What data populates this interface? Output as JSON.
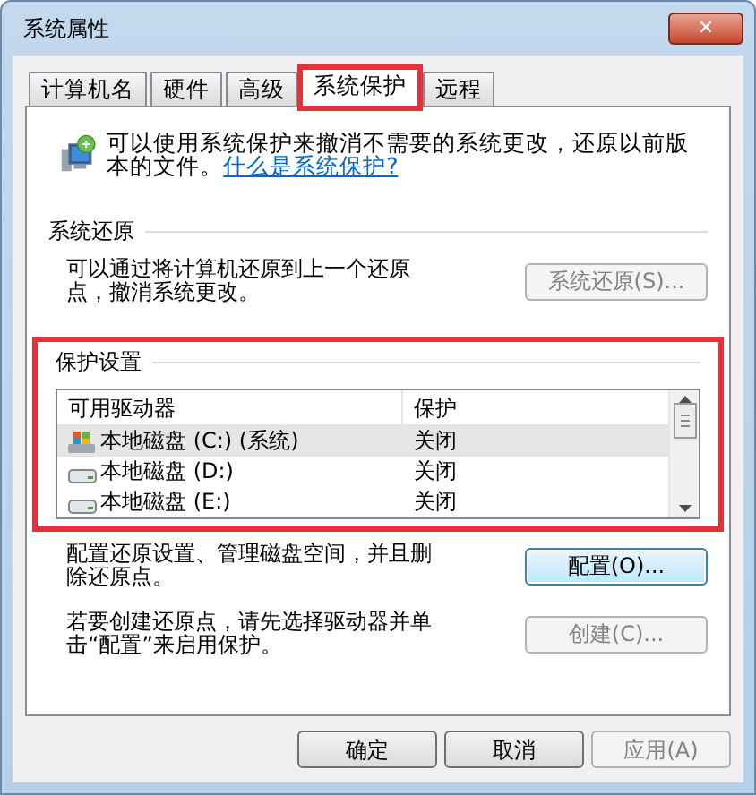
{
  "window": {
    "title": "系统属性",
    "close": "✕"
  },
  "tabs": [
    {
      "label": "计算机名",
      "selected": false
    },
    {
      "label": "硬件",
      "selected": false
    },
    {
      "label": "高级",
      "selected": false
    },
    {
      "label": "系统保护",
      "selected": true,
      "highlighted": true
    },
    {
      "label": "远程",
      "selected": false
    }
  ],
  "intro": {
    "text": "可以使用系统保护来撤消不需要的系统更改，还原以前版本的文件。",
    "link": "什么是系统保护?"
  },
  "restore": {
    "heading": "系统还原",
    "text": "可以通过将计算机还原到上一个还原点，撤消系统更改。",
    "button": {
      "label": "系统还原(S)...",
      "disabled": true
    }
  },
  "protection": {
    "heading": "保护设置",
    "highlighted": true,
    "columns": [
      "可用驱动器",
      "保护"
    ],
    "drives": [
      {
        "kind": "system",
        "name": "本地磁盘 (C:) (系统)",
        "protection": "关闭",
        "selected": true
      },
      {
        "kind": "disk",
        "name": "本地磁盘 (D:)",
        "protection": "关闭",
        "selected": false
      },
      {
        "kind": "disk",
        "name": "本地磁盘 (E:)",
        "protection": "关闭",
        "selected": false
      }
    ],
    "configure": {
      "text": "配置还原设置、管理磁盘空间，并且删除还原点。",
      "button": {
        "label": "配置(O)...",
        "disabled": false,
        "focused": true
      }
    },
    "create": {
      "text": "若要创建还原点，请先选择驱动器并单击“配置”来启用保护。",
      "button": {
        "label": "创建(C)...",
        "disabled": true
      }
    }
  },
  "buttons": [
    {
      "label": "确定",
      "disabled": false
    },
    {
      "label": "取消",
      "disabled": false
    },
    {
      "label": "应用(A)",
      "disabled": true
    }
  ]
}
